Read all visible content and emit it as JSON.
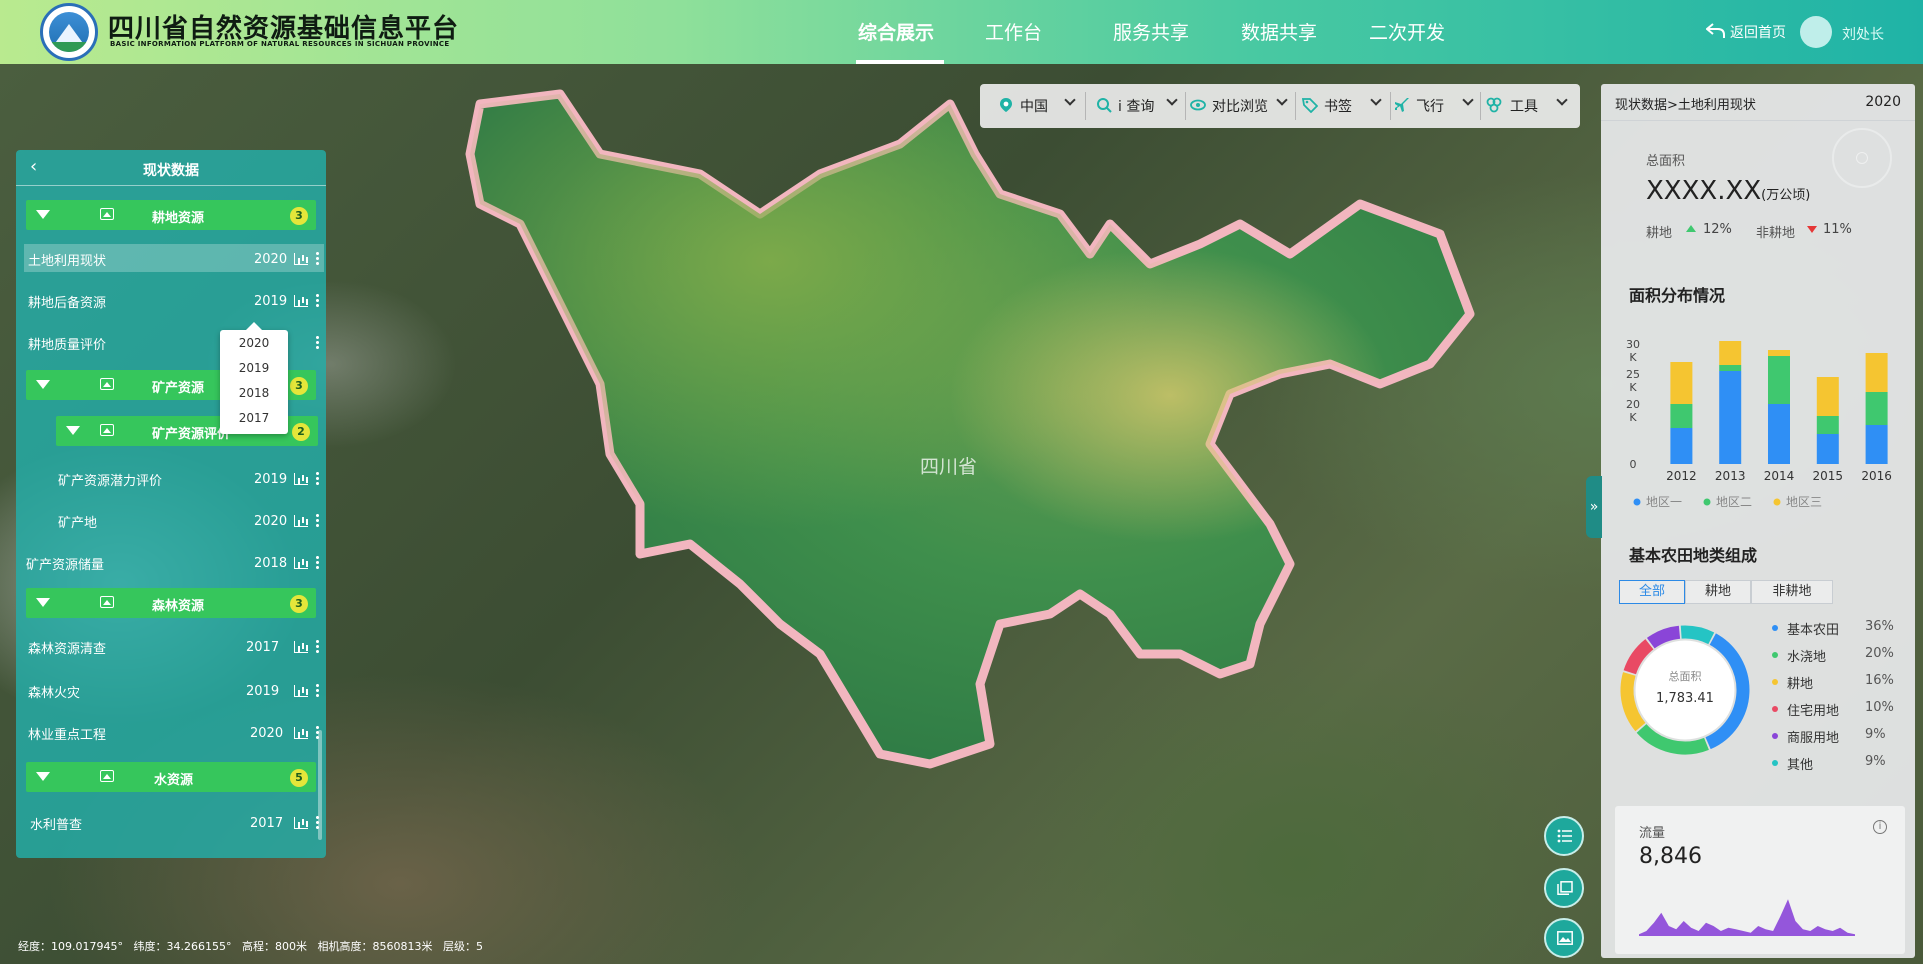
{
  "header": {
    "title": "四川省自然资源基础信息平台",
    "subtitle": "BASIC INFORMATION PLATFORM OF NATURAL RESOURCES IN SICHUAN PROVINCE",
    "nav": [
      {
        "label": "综合展示",
        "active": true
      },
      {
        "label": "工作台",
        "active": false
      },
      {
        "label": "服务共享",
        "active": false
      },
      {
        "label": "数据共享",
        "active": false
      },
      {
        "label": "二次开发",
        "active": false
      }
    ],
    "home_label": "返回首页",
    "user_name": "刘处长"
  },
  "left_panel": {
    "title": "现状数据",
    "categories": [
      {
        "label": "耕地资源",
        "count": "3"
      },
      {
        "label": "矿产资源",
        "count": "3"
      },
      {
        "label": "矿产资源评价",
        "count": "2"
      },
      {
        "label": "森林资源",
        "count": "3"
      },
      {
        "label": "水资源",
        "count": "5"
      }
    ],
    "rows": [
      {
        "name": "土地利用现状",
        "year": "2020"
      },
      {
        "name": "耕地后备资源",
        "year": "2019"
      },
      {
        "name": "耕地质量评价",
        "year": ""
      },
      {
        "name": "矿产资源潜力评价",
        "year": "2019"
      },
      {
        "name": "矿产地",
        "year": "2020"
      },
      {
        "name": "矿产资源储量",
        "year": "2018"
      },
      {
        "name": "森林资源清查",
        "year": "2017"
      },
      {
        "name": "森林火灾",
        "year": "2019"
      },
      {
        "name": "林业重点工程",
        "year": "2020"
      },
      {
        "name": "水利普查",
        "year": "2017"
      }
    ],
    "year_dropdown": [
      "2020",
      "2019",
      "2018",
      "2017"
    ]
  },
  "toolbar": {
    "items": [
      {
        "label": "中国",
        "icon": "location-pin-icon"
      },
      {
        "label": "i 查询",
        "icon": "search-icon"
      },
      {
        "label": "对比浏览",
        "icon": "eye-icon"
      },
      {
        "label": "书签",
        "icon": "tag-icon"
      },
      {
        "label": "飞行",
        "icon": "airplane-icon"
      },
      {
        "label": "工具",
        "icon": "tools-icon"
      }
    ]
  },
  "map": {
    "province_label": "四川省",
    "status": {
      "lon": "经度：109.017945°",
      "lat": "纬度：34.266155°",
      "elev": "高程：800米",
      "cam": "相机高度：8560813米",
      "level": "层级：5"
    }
  },
  "right_panel": {
    "breadcrumb": "现状数据>土地利用现状",
    "year": "2020",
    "total_label": "总面积",
    "total_value": "XXXX.XX",
    "total_unit": "(万公顷)",
    "gd_label": "耕地",
    "gd_pct": "12%",
    "fgd_label": "非耕地",
    "fgd_pct": "11%",
    "area_title": "面积分布情况",
    "farm_title": "基本农田地类组成",
    "farm_tabs": [
      "全部",
      "耕地",
      "非耕地"
    ],
    "donut_center_label": "总面积",
    "donut_center_value": "1,783.41",
    "flow_label": "流量",
    "flow_value": "8,846",
    "colors": {
      "blue": "#2f8ff5",
      "green": "#3fc86f",
      "yellow": "#f5c531",
      "red": "#e94a64",
      "purple": "#8a45d8",
      "teal": "#25c4c4"
    }
  },
  "chart_data": [
    {
      "type": "bar",
      "stacked": true,
      "categories": [
        "2012",
        "2013",
        "2014",
        "2015",
        "2016"
      ],
      "series": [
        {
          "name": "地区一",
          "values": [
            12,
            31,
            20,
            10,
            13
          ]
        },
        {
          "name": "地区二",
          "values": [
            8,
            2,
            16,
            6,
            11
          ]
        },
        {
          "name": "地区三",
          "values": [
            14,
            8,
            2,
            13,
            13
          ]
        }
      ],
      "ytick_labels": [
        "0",
        "20 K",
        "25 K",
        "30 K"
      ],
      "legend": "bottom"
    },
    {
      "type": "pie",
      "donut": true,
      "labels": [
        "基本农田",
        "水浇地",
        "耕地",
        "住宅用地",
        "商服用地",
        "其他"
      ],
      "values": [
        36,
        20,
        16,
        10,
        9,
        9
      ],
      "pct_labels": [
        "36%",
        "20%",
        "16%",
        "10%",
        "9%",
        "9%"
      ]
    },
    {
      "type": "area",
      "values": [
        1,
        3,
        8,
        14,
        6,
        4,
        9,
        5,
        3,
        8,
        6,
        3,
        5,
        4,
        3,
        2,
        6,
        4,
        3,
        12,
        22,
        9,
        4,
        3,
        6,
        4,
        3,
        5,
        2,
        1
      ]
    }
  ]
}
